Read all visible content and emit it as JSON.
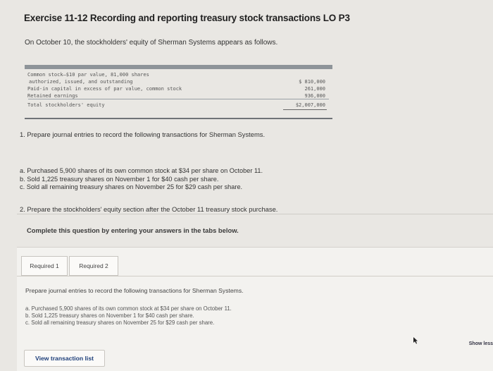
{
  "title": "Exercise 11-12 Recording and reporting treasury stock transactions LO P3",
  "intro": "On October 10, the stockholders' equity of Sherman Systems appears as follows.",
  "equity_table": {
    "rows": [
      {
        "label": "Common stock—$10 par value, 81,000 shares",
        "amount": ""
      },
      {
        "label": "authorized, issued, and outstanding",
        "amount": "$ 810,000",
        "dollar": "$"
      },
      {
        "label": "Paid-in capital in excess of par value, common stock",
        "amount": "261,000"
      },
      {
        "label": "Retained earnings",
        "amount": "936,000"
      },
      {
        "label": "Total stockholders' equity",
        "amount": "$2,007,000"
      }
    ]
  },
  "question1": "1. Prepare journal entries to record the following transactions for Sherman Systems.",
  "transactions": [
    "a. Purchased 5,900 shares of its own common stock at $34 per share on October 11.",
    "b. Sold 1,225 treasury shares on November 1 for $40 cash per share.",
    "c. Sold all remaining treasury shares on November 25 for $29 cash per share."
  ],
  "question2": "2. Prepare the stockholders' equity section after the October 11 treasury stock purchase.",
  "complete_instruction": "Complete this question by entering your answers in the tabs below.",
  "tabs": [
    "Required 1",
    "Required 2"
  ],
  "panel": {
    "prepare": "Prepare journal entries to record the following transactions for Sherman Systems.",
    "items": [
      "a. Purchased 5,900 shares of its own common stock at $34 per share on October 11.",
      "b. Sold 1,225 treasury shares on November 1 for $40 cash per share.",
      "c. Sold all remaining treasury shares on November 25 for $29 cash per share."
    ],
    "show_less": "Show less",
    "view_button": "View transaction list"
  }
}
